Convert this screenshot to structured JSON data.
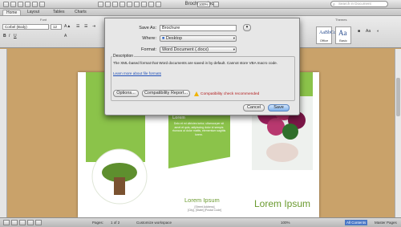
{
  "window": {
    "title": "Brochure.docx",
    "zoom": "100%",
    "search_placeholder": "Search in Document"
  },
  "ribbon": {
    "tabs": [
      "Home",
      "Layout",
      "Tables",
      "Charts"
    ],
    "font_group_label": "Font",
    "font_name": "Corbel (Body)",
    "font_size": "12",
    "styles_label": "Themes",
    "style_boxes": [
      {
        "sample": "AaBbCcDdEe",
        "label": "Office"
      },
      {
        "sample": "Aa",
        "label": "Basic"
      }
    ]
  },
  "dialog": {
    "save_as_label": "Save As:",
    "save_as_value": "Brochure",
    "where_label": "Where:",
    "where_value": "Desktop",
    "format_label": "Format:",
    "format_value": "Word Document (.docx)",
    "description_title": "Description",
    "description_text": "The XML-based format that Word documents are saved in by default. Cannot store VBA macro code.",
    "learn_more": "Learn more about file formats",
    "options_button": "Options...",
    "compat_report_button": "Compatibility Report...",
    "compat_warning": "Compatibility check recommended",
    "cancel_button": "Cancel",
    "save_button": "Save"
  },
  "document": {
    "panel2_title": "Lorem",
    "panel2_text": "Dolo et mi ultricies tortor, ullamcorper sit amet et quis, adipiscing dolor id sempis rhoncus ut dolor mattis, elementum sagittis lorem.",
    "heading1": "Lorem Ipsum",
    "address": "[Street Address]\n[City], [State] [Postal Code]",
    "heading2": "Lorem Ipsum"
  },
  "status": {
    "pages_label": "Pages:",
    "pages_value": "1 of 2",
    "workspace": "Customize workspace",
    "zoom": "100%",
    "views": "All Contents",
    "master": "Master Pages"
  }
}
